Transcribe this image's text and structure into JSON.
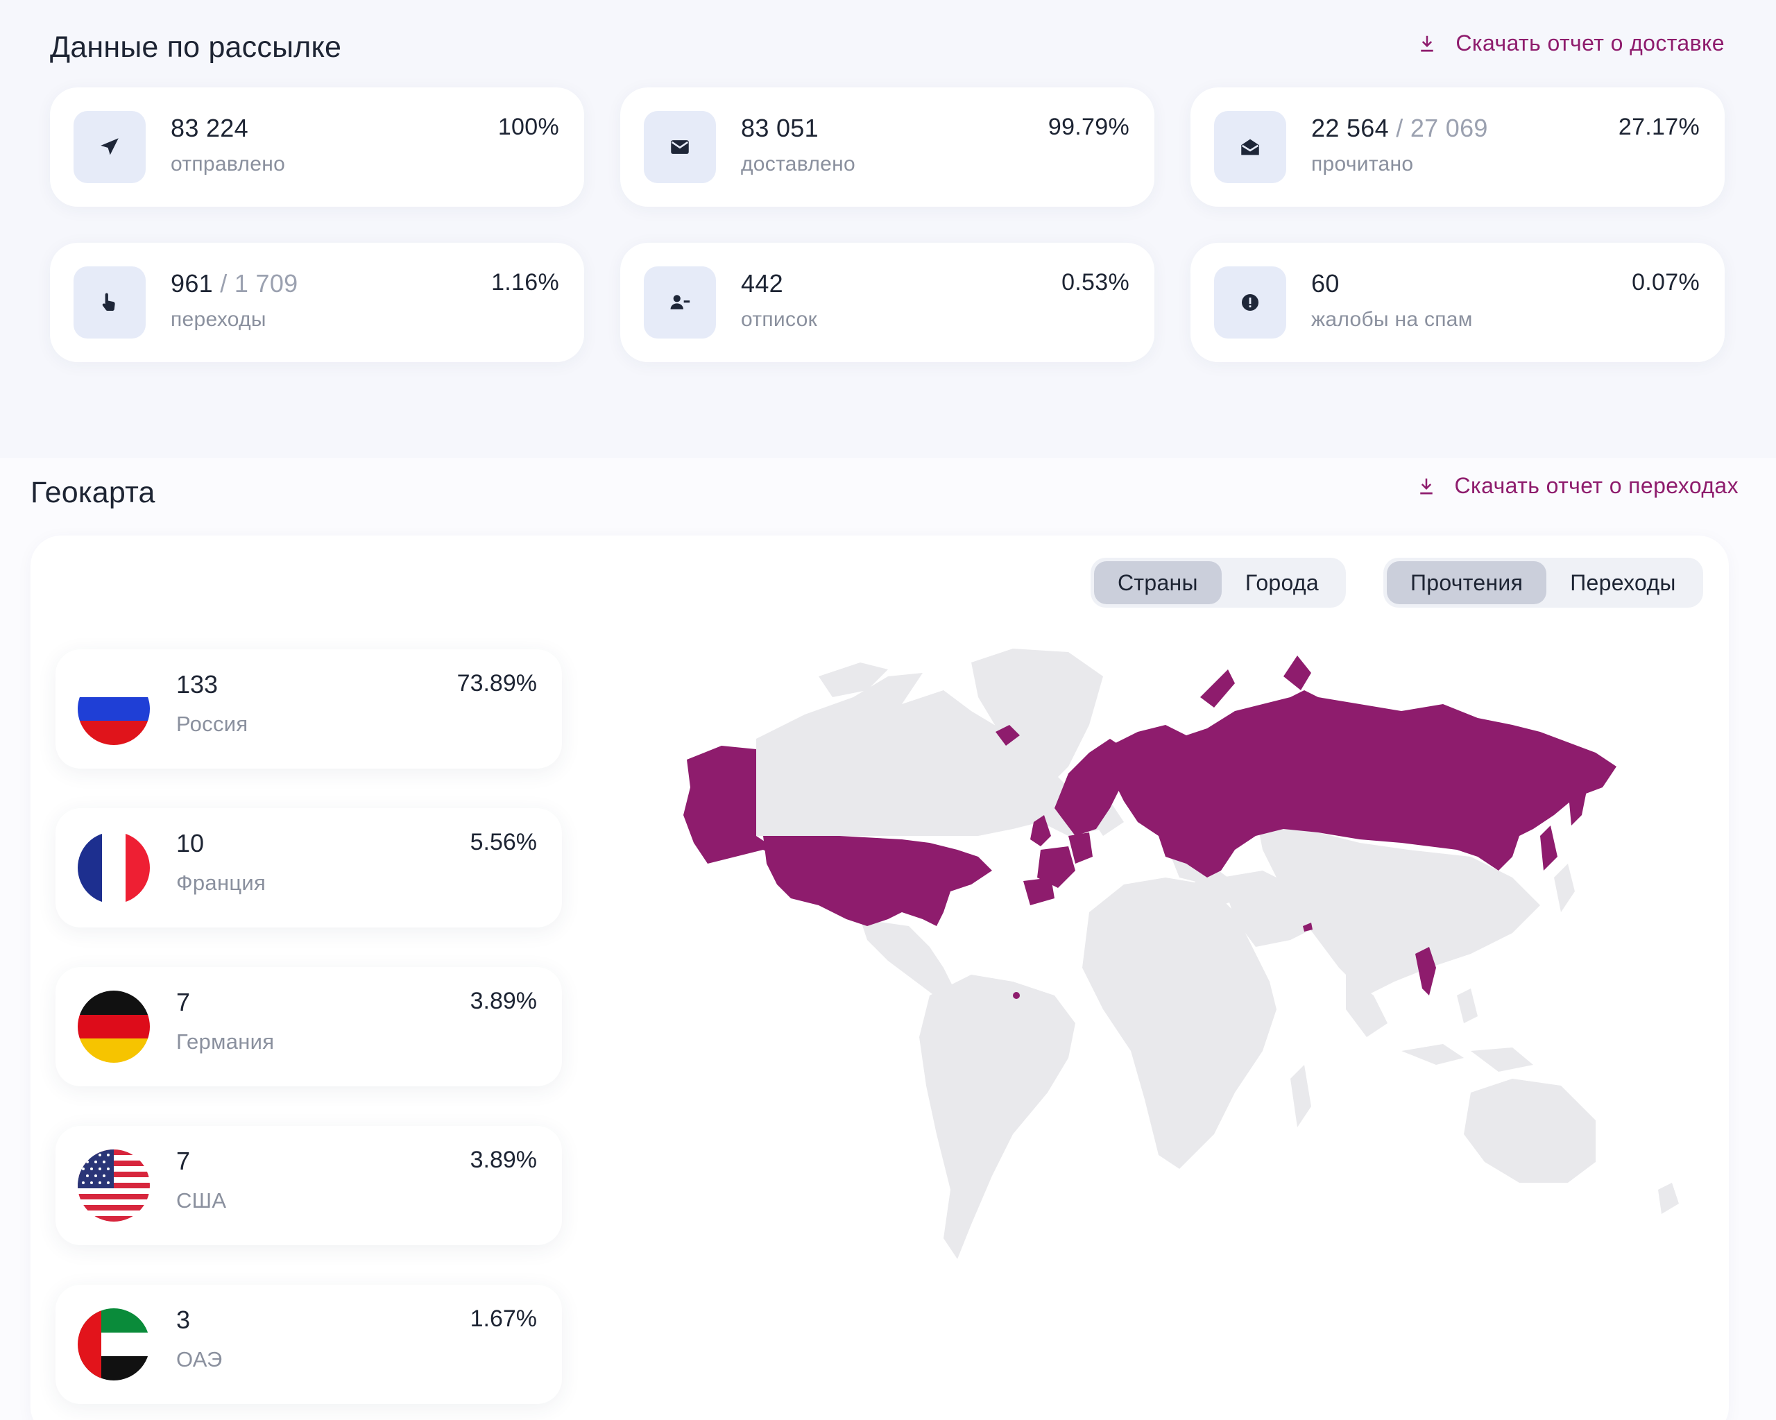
{
  "delivery": {
    "title": "Данные по рассылке",
    "download_label": "Скачать отчет о доставке",
    "stats": [
      {
        "icon": "send-icon",
        "value": "83 224",
        "total": "",
        "label": "отправлено",
        "percent": "100%"
      },
      {
        "icon": "envelope-icon",
        "value": "83 051",
        "total": "",
        "label": "доставлено",
        "percent": "99.79%"
      },
      {
        "icon": "envelope-open-icon",
        "value": "22 564",
        "total": "/ 27 069",
        "label": "прочитано",
        "percent": "27.17%"
      },
      {
        "icon": "pointer-hand-icon",
        "value": "961",
        "total": "/ 1 709",
        "label": "переходы",
        "percent": "1.16%"
      },
      {
        "icon": "user-minus-icon",
        "value": "442",
        "total": "",
        "label": "отписок",
        "percent": "0.53%"
      },
      {
        "icon": "alert-circle-icon",
        "value": "60",
        "total": "",
        "label": "жалобы на спам",
        "percent": "0.07%"
      }
    ]
  },
  "geo": {
    "title": "Геокарта",
    "download_label": "Скачать отчет о переходах",
    "scope_toggle": {
      "options": [
        "Страны",
        "Города"
      ],
      "active": "Страны"
    },
    "metric_toggle": {
      "options": [
        "Прочтения",
        "Переходы"
      ],
      "active": "Прочтения"
    },
    "highlight_color": "#8e1c6d",
    "base_land_color": "#e9e9ec",
    "countries": [
      {
        "flag": "russia-flag-icon",
        "count": "133",
        "name": "Россия",
        "percent": "73.89%"
      },
      {
        "flag": "france-flag-icon",
        "count": "10",
        "name": "Франция",
        "percent": "5.56%"
      },
      {
        "flag": "germany-flag-icon",
        "count": "7",
        "name": "Германия",
        "percent": "3.89%"
      },
      {
        "flag": "usa-flag-icon",
        "count": "7",
        "name": "США",
        "percent": "3.89%"
      },
      {
        "flag": "uae-flag-icon",
        "count": "3",
        "name": "ОАЭ",
        "percent": "1.67%"
      }
    ]
  }
}
